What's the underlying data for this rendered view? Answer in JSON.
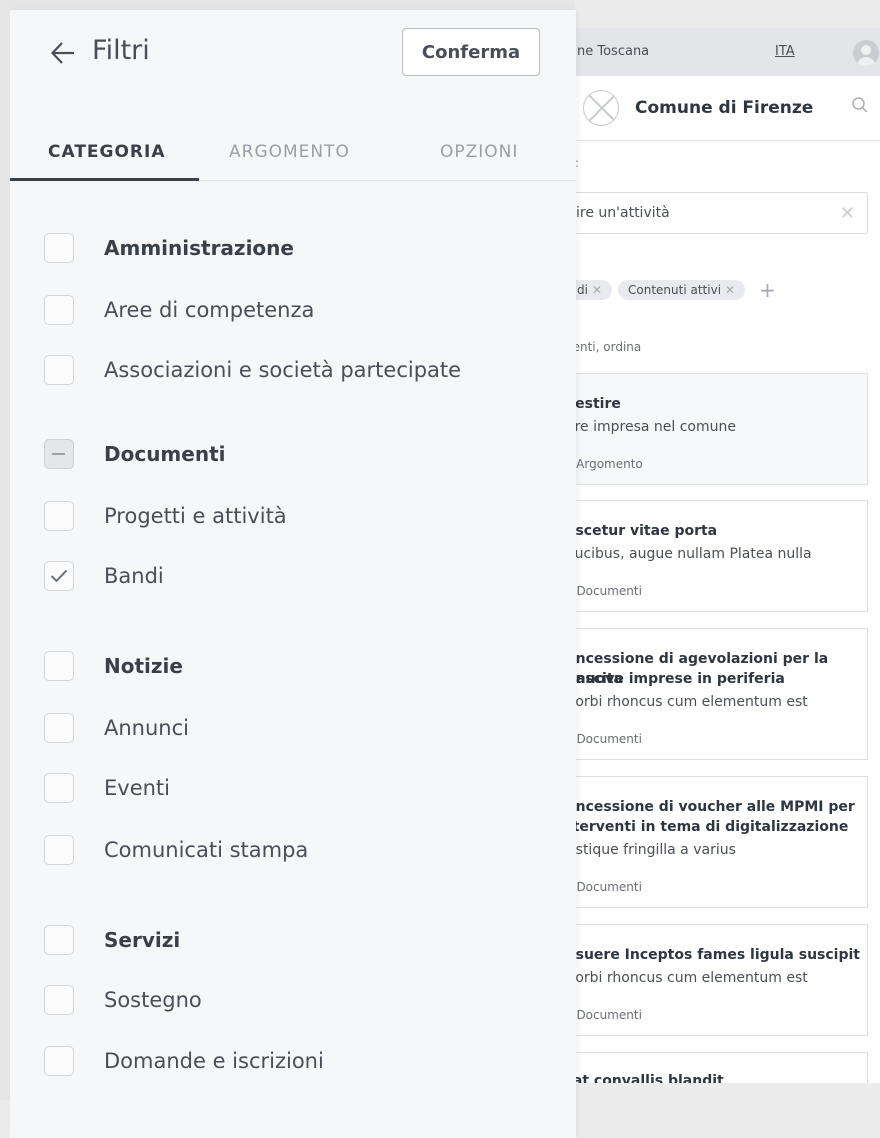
{
  "background_page": {
    "region_text": "ne Toscana",
    "lang": "ITA",
    "site_title": "Comune di Firenze",
    "filter_label": ":",
    "search_value": "ire un'attività",
    "chips": [
      {
        "label": "di"
      },
      {
        "label": "Contenuti attivi"
      }
    ],
    "results_info": "nenti, ordina",
    "cards": [
      {
        "title": "vestire",
        "desc": "are impresa nel comune",
        "category": "Argomento",
        "icon": "tag-icon"
      },
      {
        "title": "ascetur vitae porta",
        "desc": "aucibus, augue nullam Platea nulla",
        "category": "Documenti",
        "icon": "document-icon"
      },
      {
        "title": "oncessione di agevolazioni per la nascita",
        "title2": "i nuove imprese in periferia",
        "desc": "Aorbi rhoncus cum elementum est",
        "category": "Documenti",
        "icon": "document-icon"
      },
      {
        "title": "oncessione di voucher alle MPMI per",
        "title2": "tterventi in tema di digitalizzazione",
        "desc": "ristique fringilla a varius",
        "category": "Documenti",
        "icon": "document-icon"
      },
      {
        "title": "osuere Inceptos fames ligula suscipit",
        "desc": "Aorbi rhoncus cum elementum est",
        "category": "Documenti",
        "icon": "document-icon"
      },
      {
        "title": "rat convallis blandit"
      }
    ]
  },
  "panel": {
    "title": "Filtri",
    "confirm_label": "Conferma",
    "tabs": [
      {
        "label": "CATEGORIA",
        "active": true
      },
      {
        "label": "ARGOMENTO",
        "active": false
      },
      {
        "label": "OPZIONI",
        "active": false
      }
    ],
    "categories": [
      {
        "label": "Amministrazione",
        "group": true,
        "state": "unchecked"
      },
      {
        "label": "Aree di competenza",
        "group": false,
        "state": "unchecked"
      },
      {
        "label": "Associazioni e società partecipate",
        "group": false,
        "state": "unchecked"
      },
      {
        "label": "Documenti",
        "group": true,
        "state": "indeterminate"
      },
      {
        "label": "Progetti e attività",
        "group": false,
        "state": "unchecked"
      },
      {
        "label": "Bandi",
        "group": false,
        "state": "checked"
      },
      {
        "label": "Notizie",
        "group": true,
        "state": "unchecked"
      },
      {
        "label": "Annunci",
        "group": false,
        "state": "unchecked"
      },
      {
        "label": "Eventi",
        "group": false,
        "state": "unchecked"
      },
      {
        "label": "Comunicati stampa",
        "group": false,
        "state": "unchecked"
      },
      {
        "label": "Servizi",
        "group": true,
        "state": "unchecked"
      },
      {
        "label": "Sostegno",
        "group": false,
        "state": "unchecked"
      },
      {
        "label": "Domande e iscrizioni",
        "group": false,
        "state": "unchecked"
      }
    ]
  },
  "colors": {
    "text_dark": "#3a3f48",
    "text_muted": "#9a9ea6",
    "panel_bg": "#f6f7f8",
    "checkbox_border": "#d2d5da"
  }
}
